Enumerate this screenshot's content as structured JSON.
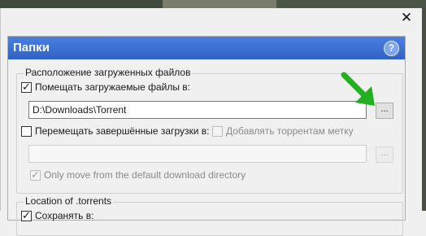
{
  "window": {
    "close_glyph": "✕"
  },
  "panel": {
    "title": "Папки",
    "help_glyph": "?"
  },
  "group_downloads": {
    "title": "Расположение загруженных файлов",
    "put_files_label": "Помещать загружаемые файлы в:",
    "put_files_checked": true,
    "put_files_path": "D:\\Downloads\\Torrent",
    "browse_label": "...",
    "move_completed_label": "Перемещать завершённые загрузки в:",
    "move_completed_checked": false,
    "add_label_label": "Добавлять торрентам метку",
    "add_label_checked": false,
    "move_completed_path": "",
    "browse2_label": "...",
    "only_move_label": "Only move from the default download directory",
    "only_move_checked": true
  },
  "group_torrents": {
    "title": "Location of .torrents",
    "save_label": "Сохранять в:",
    "save_checked": true
  },
  "colors": {
    "accent": "#3c6fd0",
    "arrow": "#22b020"
  }
}
